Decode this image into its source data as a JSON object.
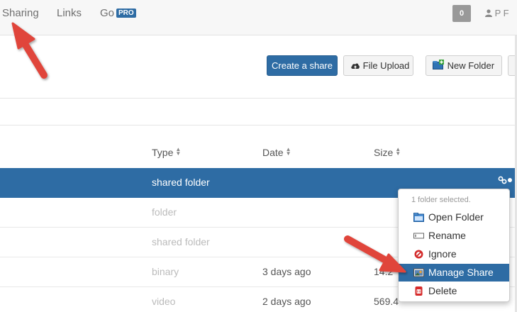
{
  "nav": {
    "items": [
      "Sharing",
      "Links",
      "Go"
    ],
    "pro_badge": "PRO",
    "notification_count": "0",
    "user_initials": "P F"
  },
  "toolbar": {
    "create_share": "Create a share",
    "file_upload": "File Upload",
    "new_folder": "New Folder"
  },
  "table": {
    "headers": {
      "type": "Type",
      "date": "Date",
      "size": "Size"
    },
    "rows": [
      {
        "type": "shared folder",
        "date": "",
        "size": "",
        "selected": true
      },
      {
        "type": "folder",
        "date": "",
        "size": ""
      },
      {
        "type": "shared folder",
        "date": "",
        "size": ""
      },
      {
        "type": "binary",
        "date": "3 days ago",
        "size": "14.2"
      },
      {
        "type": "video",
        "date": "2 days ago",
        "size": "569.4"
      }
    ]
  },
  "context_menu": {
    "header": "1 folder selected.",
    "items": [
      {
        "label": "Open Folder",
        "icon": "folder-icon"
      },
      {
        "label": "Rename",
        "icon": "rename-icon"
      },
      {
        "label": "Ignore",
        "icon": "ignore-icon"
      },
      {
        "label": "Manage Share",
        "icon": "manage-share-icon",
        "active": true
      },
      {
        "label": "Delete",
        "icon": "delete-icon"
      }
    ]
  },
  "colors": {
    "accent": "#2e6ca4",
    "arrow": "#e0443a"
  }
}
